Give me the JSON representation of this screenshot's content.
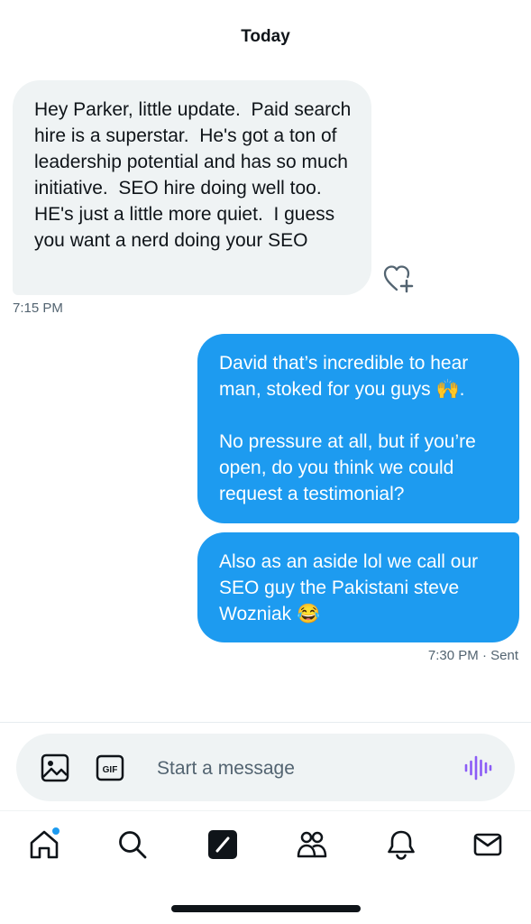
{
  "thread": {
    "day_label": "Today",
    "messages": [
      {
        "direction": "incoming",
        "text": "Hey Parker, little update.  Paid search hire is a superstar.  He's got a ton of leadership potential and has so much initiative.  SEO hire doing well too.  HE's just a little more quiet.  I guess you want a nerd doing your SEO",
        "time": "7:15 PM"
      },
      {
        "direction": "outgoing",
        "text": "David that’s incredible to hear man, stoked for you guys 🙌.\n\nNo pressure at all, but if you’re open, do you think we could request a testimonial?"
      },
      {
        "direction": "outgoing",
        "text": "Also as an aside lol we call our SEO guy the Pakistani steve Wozniak 😂",
        "time": "7:30 PM",
        "status": "· Sent"
      }
    ]
  },
  "composer": {
    "placeholder": "Start a message",
    "icons": [
      "image-icon",
      "gif-icon",
      "voice-icon"
    ]
  },
  "tab_bar": {
    "items": [
      "home-icon",
      "search-icon",
      "compose-icon",
      "communities-icon",
      "notifications-icon",
      "messages-icon"
    ],
    "home_notification_dot": true
  },
  "colors": {
    "accent": "#1d9bf0",
    "incoming_bubble": "#eff3f4",
    "voice_icon": "#8b5cf6"
  }
}
